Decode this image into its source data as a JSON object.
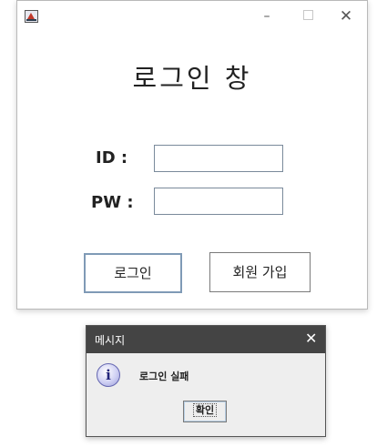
{
  "main_window": {
    "icon": "java-app-icon",
    "controls": {
      "minimize": "–",
      "maximize": "□",
      "close": "✕"
    },
    "title": "로그인 창",
    "id_label": "ID :",
    "pw_label": "PW :",
    "id_value": "",
    "pw_value": "",
    "login_button": "로그인",
    "signup_button": "회원 가입"
  },
  "dialog": {
    "title": "메시지",
    "close": "✕",
    "icon": "info-icon",
    "icon_glyph": "i",
    "message": "로그인 실패",
    "ok_button": "확인"
  }
}
